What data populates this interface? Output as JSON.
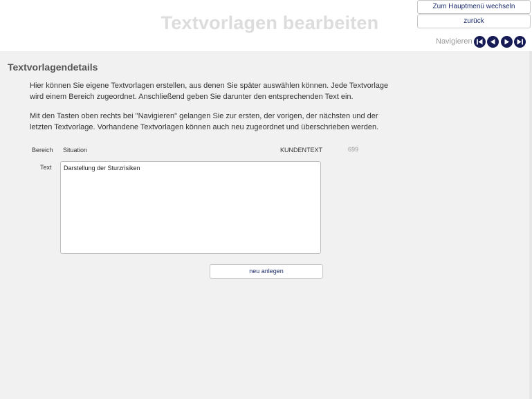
{
  "header": {
    "title": "Textvorlagen bearbeiten",
    "main_menu_label": "Zum Hauptmenü wechseln",
    "back_label": "zurück",
    "nav_label": "Navigieren"
  },
  "icons": {
    "nav_first": "first-record-icon",
    "nav_prev": "previous-record-icon",
    "nav_next": "next-record-icon",
    "nav_last": "last-record-icon"
  },
  "colors": {
    "nav_button": "#161a55",
    "button_text": "#1a2a6a",
    "title_text": "#dcdcdc"
  },
  "details": {
    "section_title": "Textvorlagendetails",
    "paragraph1_line1": "Hier können Sie eigene Textvorlagen erstellen, aus denen Sie später auswählen können. Jede Textvorlage",
    "paragraph1_line2": "wird einem Bereich zugeordnet. Anschließend geben Sie darunter den entsprechenden Text ein.",
    "paragraph2_line1": "Mit den Tasten oben rechts bei \"Navigieren\" gelangen Sie zur ersten, der vorigen, der nächsten und der",
    "paragraph2_line2": "letzten Textvorlage. Vorhandene Textvorlagen können auch neu zugeordnet und überschrieben werden."
  },
  "form": {
    "bereich_label": "Bereich",
    "bereich_value": "Situation",
    "type_value": "KUNDENTEXT",
    "id_value": "699",
    "text_label": "Text",
    "text_value": "Darstellung der Sturzrisiken",
    "new_button_label": "neu anlegen"
  }
}
